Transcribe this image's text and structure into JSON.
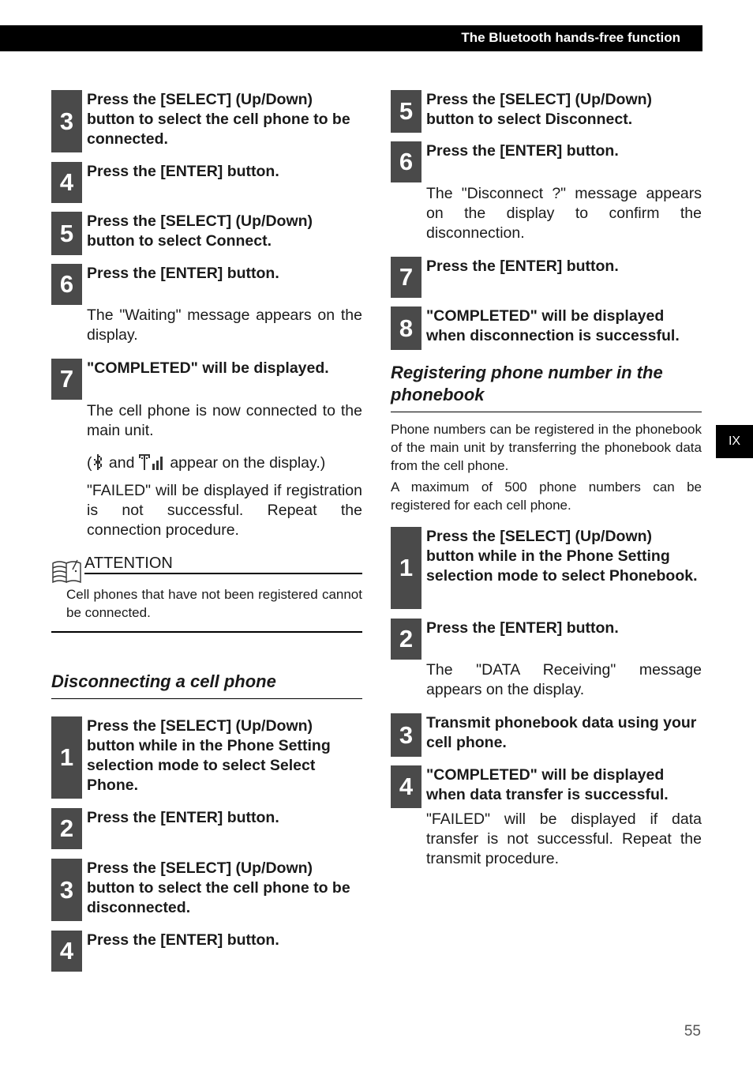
{
  "header": {
    "title": "The Bluetooth hands-free function"
  },
  "side_tab": {
    "label": "IX"
  },
  "page_number": "55",
  "left": {
    "steps_connect": [
      {
        "num": "3",
        "text": "Press the [SELECT] (Up/Down) button to select the cell phone to be connected."
      },
      {
        "num": "4",
        "text": "Press the [ENTER] button."
      },
      {
        "num": "5",
        "text": "Press the [SELECT] (Up/Down) button to select Connect."
      },
      {
        "num": "6",
        "text": "Press the [ENTER] button."
      },
      {
        "num": "7",
        "text": "\"COMPLETED\" will be displayed."
      }
    ],
    "waiting_note": "The \"Waiting\" message appears on the display.",
    "connected_note": "The cell phone is now connected to the main unit.",
    "icons_note_open": "(",
    "icons_note_and": "and",
    "icons_note_close": "appear on the display.)",
    "failed_note": "\"FAILED\" will be displayed if registration is not successful. Repeat the connection procedure.",
    "attention": {
      "label": "ATTENTION",
      "text": "Cell phones that have not been registered cannot be connected."
    },
    "disconnect_title": "Disconnecting a cell phone",
    "steps_disconnect": [
      {
        "num": "1",
        "text": "Press the [SELECT] (Up/Down) button while in the Phone Setting selection mode to select Select Phone."
      },
      {
        "num": "2",
        "text": "Press the [ENTER] button."
      },
      {
        "num": "3",
        "text": "Press the [SELECT] (Up/Down) button to select the cell phone to be disconnected."
      },
      {
        "num": "4",
        "text": "Press the [ENTER] button."
      }
    ]
  },
  "right": {
    "steps_disconnect": [
      {
        "num": "5",
        "text": "Press the [SELECT] (Up/Down) button to select Disconnect."
      },
      {
        "num": "6",
        "text": "Press the [ENTER] button."
      },
      {
        "num": "7",
        "text": "Press the [ENTER] button."
      },
      {
        "num": "8",
        "text": "\"COMPLETED\" will be displayed when disconnection is successful."
      }
    ],
    "disconnect_note": "The \"Disconnect ?\" message appears on the display to confirm the disconnection.",
    "phonebook_title": "Registering phone number in the phonebook",
    "phonebook_intro_1": "Phone numbers can be registered in the phonebook of the main unit by transferring the phonebook data from the cell phone.",
    "phonebook_intro_2": "A maximum of 500 phone numbers can be registered for each cell phone.",
    "steps_phonebook": [
      {
        "num": "1",
        "text": "Press the [SELECT] (Up/Down) button while in the Phone Setting selection mode to select Phonebook."
      },
      {
        "num": "2",
        "text": "Press the [ENTER] button."
      },
      {
        "num": "3",
        "text": "Transmit phonebook data using your cell phone."
      },
      {
        "num": "4",
        "text": "\"COMPLETED\" will be displayed when data transfer is successful."
      }
    ],
    "data_receiving_note": "The \"DATA Receiving\" message appears on the display.",
    "failed_note": "\"FAILED\" will be displayed if data transfer is not successful. Repeat the transmit procedure."
  }
}
